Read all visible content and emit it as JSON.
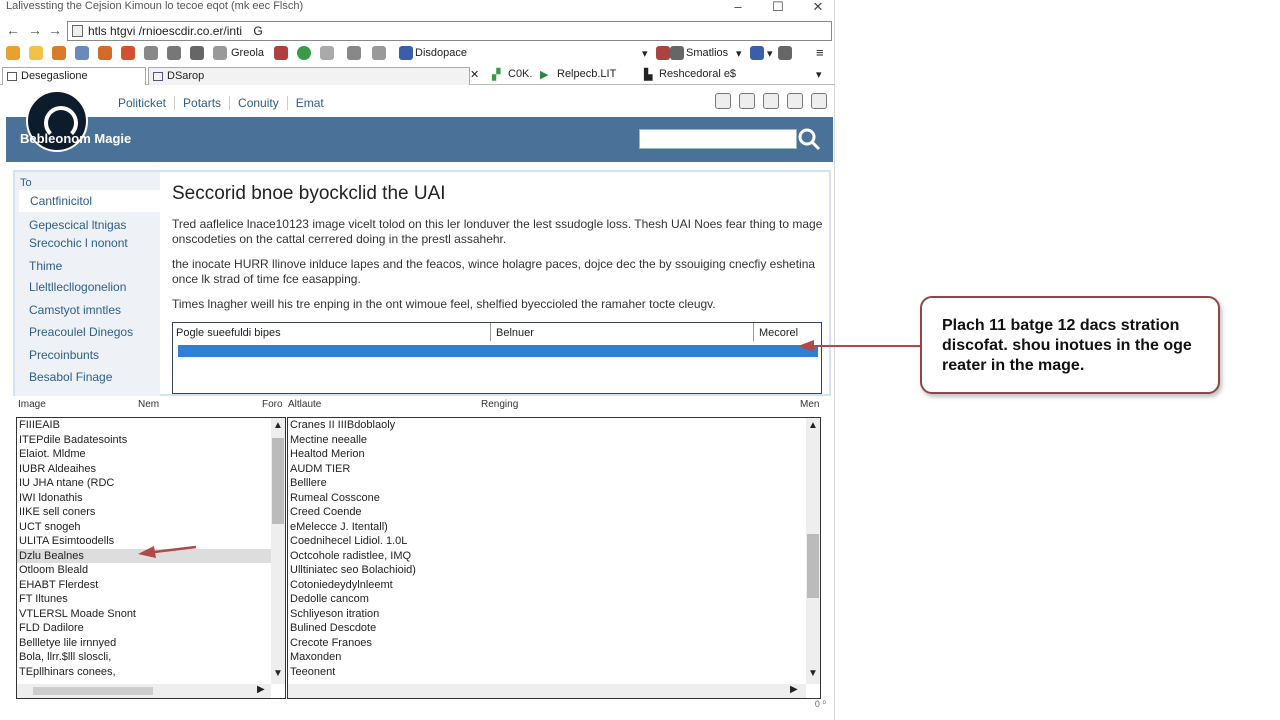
{
  "window": {
    "title": "Lalivessting the Cejsion Kimoun lo tecoe eqot (mk eec Flsch)",
    "minimize": "–",
    "maximize": "☐",
    "close": "✕"
  },
  "address_bar": {
    "url": "htls htgvi /rnioescdir.co.er/inti",
    "refresh": "G"
  },
  "toolbar": {
    "items": [
      "Greola",
      "Disdopace",
      "Smatlios",
      ""
    ],
    "dropdowns": [
      "▾",
      "▾",
      "▾"
    ]
  },
  "tabs": {
    "items": [
      {
        "label": "Desegaslione"
      },
      {
        "label": "DSarop"
      }
    ],
    "bookmarks": [
      "C0K.",
      "Relpecb.LIT",
      "Reshcedoral e$"
    ]
  },
  "site": {
    "nav": [
      "Politicket",
      "Potarts",
      "Conuity",
      "Emat"
    ],
    "brand": "Bebleonom Magie",
    "search_placeholder": ""
  },
  "sidebar": {
    "header": "To",
    "current": "Cantfinicitol",
    "items": [
      "Gepescical ltnigas",
      "Srecochic l nonont",
      "Thime",
      "Lleltllecllogonelion",
      "Camstyot imntles",
      "Preacoulel Dinegos",
      "Precoinbunts",
      "Besabol Finage"
    ]
  },
  "main": {
    "title": "Seccorid bnoe byockclid the UAI",
    "paragraphs": [
      "Tred aaflelice lnace10123 image vicelt tolod on this ler londuver the lest ssudogle loss. Thesh UAI Noes fear thing to mage onscodeties on the cattal cerrered doing in the prestl assahehr.",
      "the inocate HURR llinove inlduce lapes and the feacos, wince holagre paces, dojce dec the by ssouiging cnecfiy eshetina once lk strad of time fce easapping.",
      "Times lnagher weill his tre enping in the ont wimoue feel, shelfied byeccioled the ramaher tocte cleugv."
    ],
    "table": {
      "columns": [
        "Pogle sueefuldi bipes",
        "Belnuer",
        "Mecorel"
      ]
    }
  },
  "lists": {
    "headers": [
      "Image",
      "Nem",
      "Foro",
      "Altlaute",
      "Renging",
      "Men"
    ],
    "left": [
      "FIIIEAIB",
      "ITEPdile Badatesoints",
      "Elaiot. Mldme",
      "IUBR Aldeaihes",
      "IU JHA ntane (RDC",
      "IWI ldonathis",
      "IIKE sell coners",
      "UCT snogeh",
      "ULITA Esimtoodells",
      "Dzlu Bealnes",
      "Otloom Bleald",
      "EHABT Flerdest",
      "FT Iltunes",
      "VTLERSL Moade Snont",
      "FLD Dadilore",
      "Bellletye lile irnnyed",
      "Bola, llrr.$lll sloscli,",
      "TEpllhinars conees,"
    ],
    "right": [
      "Cranes II IIIBdoblaoly",
      "Mectine neealle",
      "Healtod Merion",
      "AUDM TIER",
      "Belllere",
      "Rumeal Cosscone",
      "Creed Coende",
      "eMelecce J. Itentall)",
      "Coednihecel Lidiol. 1.0L",
      "Octcohole radistlee, IMQ",
      "Ulltiniatec seo Bolachioid)",
      "Cotoniedeydylnleemt",
      "Dedolle cancom",
      "Schliyeson itration",
      "Bulined Descdote",
      "Crecote Franoes",
      "Maxonden",
      "Teeonent"
    ],
    "selected_left_index": 9
  },
  "callout": {
    "text": "Plach 11 batge 12 dacs stration discofat. shou inotues in the oge reater in the mage."
  },
  "status": {
    "text": "0 ⁰"
  },
  "colors": {
    "banner": "#4a7299",
    "link": "#2d5c8a",
    "table_bar": "#2f7fd2",
    "callout_border": "#8b4848",
    "arrow": "#b04a4a"
  }
}
